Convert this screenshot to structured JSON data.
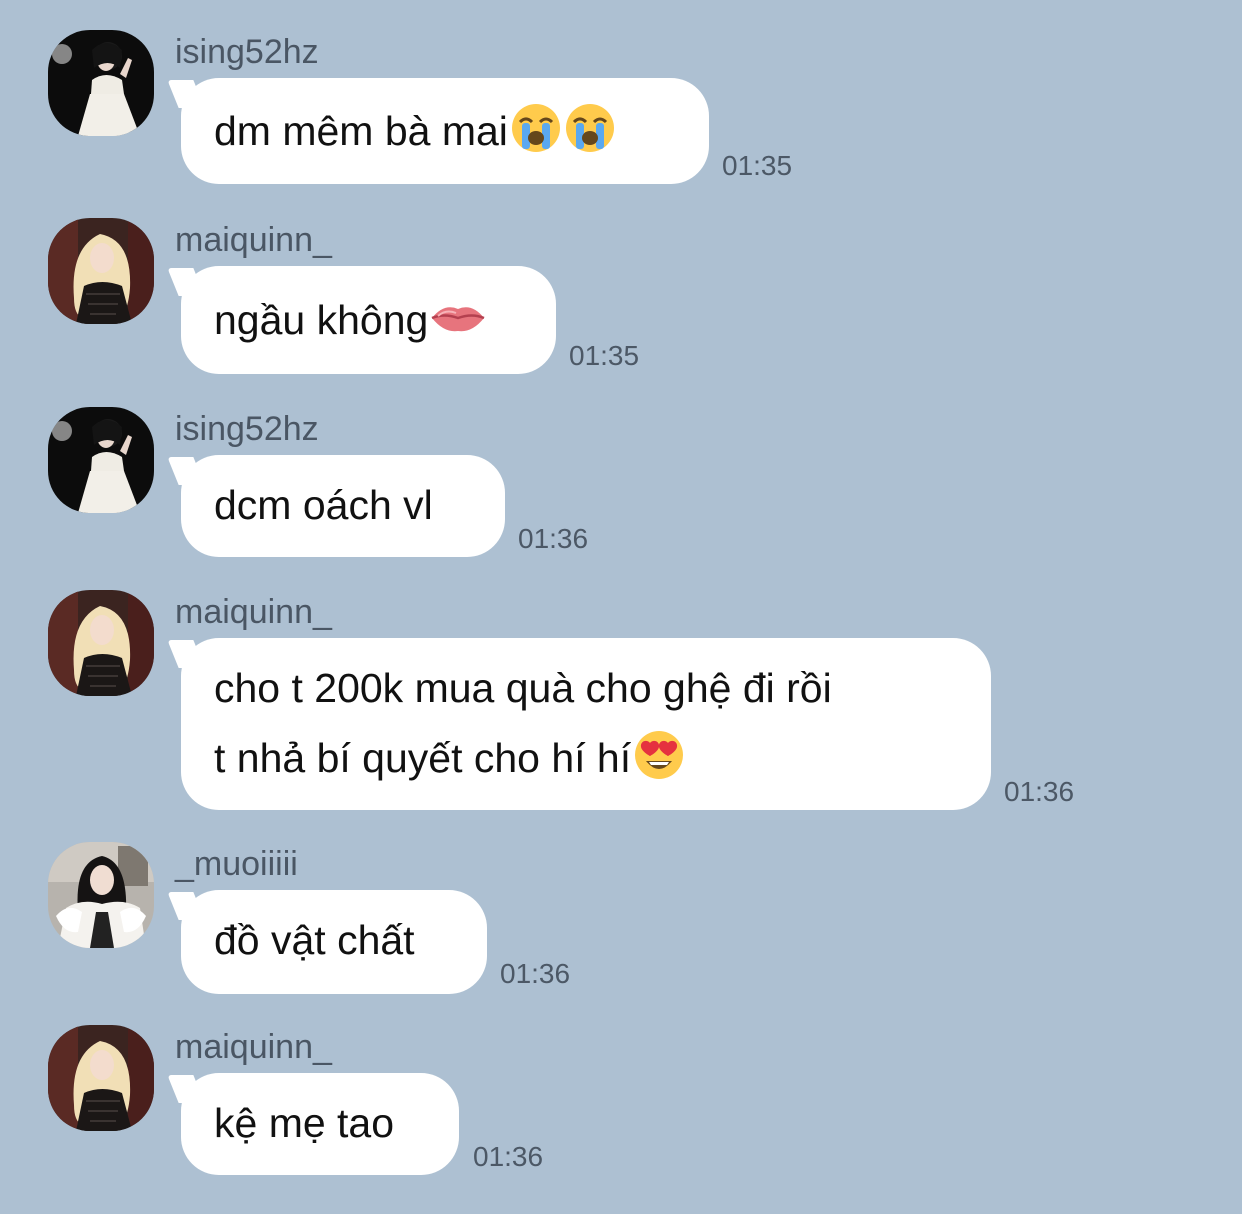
{
  "messages": [
    {
      "username": "ising52hz",
      "avatar": "ising-avatar",
      "lines": [
        "dm mêm bà mai"
      ],
      "emojis": [
        "loudly-crying-face-icon",
        "loudly-crying-face-icon"
      ],
      "time": "01:35"
    },
    {
      "username": "maiquinn_",
      "avatar": "maiquinn-avatar",
      "lines": [
        "ngầu không"
      ],
      "emojis": [
        "lips-icon"
      ],
      "time": "01:35"
    },
    {
      "username": "ising52hz",
      "avatar": "ising-avatar",
      "lines": [
        "dcm oách vl"
      ],
      "emojis": [],
      "time": "01:36"
    },
    {
      "username": "maiquinn_",
      "avatar": "maiquinn-avatar",
      "lines": [
        "cho t 200k mua quà cho ghệ đi rồi",
        "t nhả bí quyết cho hí hí"
      ],
      "emojis": [
        "heart-eyes-face-icon"
      ],
      "time": "01:36"
    },
    {
      "username": "_muoiiiii",
      "avatar": "muoi-avatar",
      "lines": [
        "đồ vật chất"
      ],
      "emojis": [],
      "time": "01:36"
    },
    {
      "username": "maiquinn_",
      "avatar": "maiquinn-avatar",
      "lines": [
        "kệ mẹ tao"
      ],
      "emojis": [],
      "time": "01:36"
    }
  ],
  "colors": {
    "background": "#adc0d2",
    "bubble": "#ffffff",
    "username_text": "#4a5664",
    "time_text": "#4c5866"
  }
}
